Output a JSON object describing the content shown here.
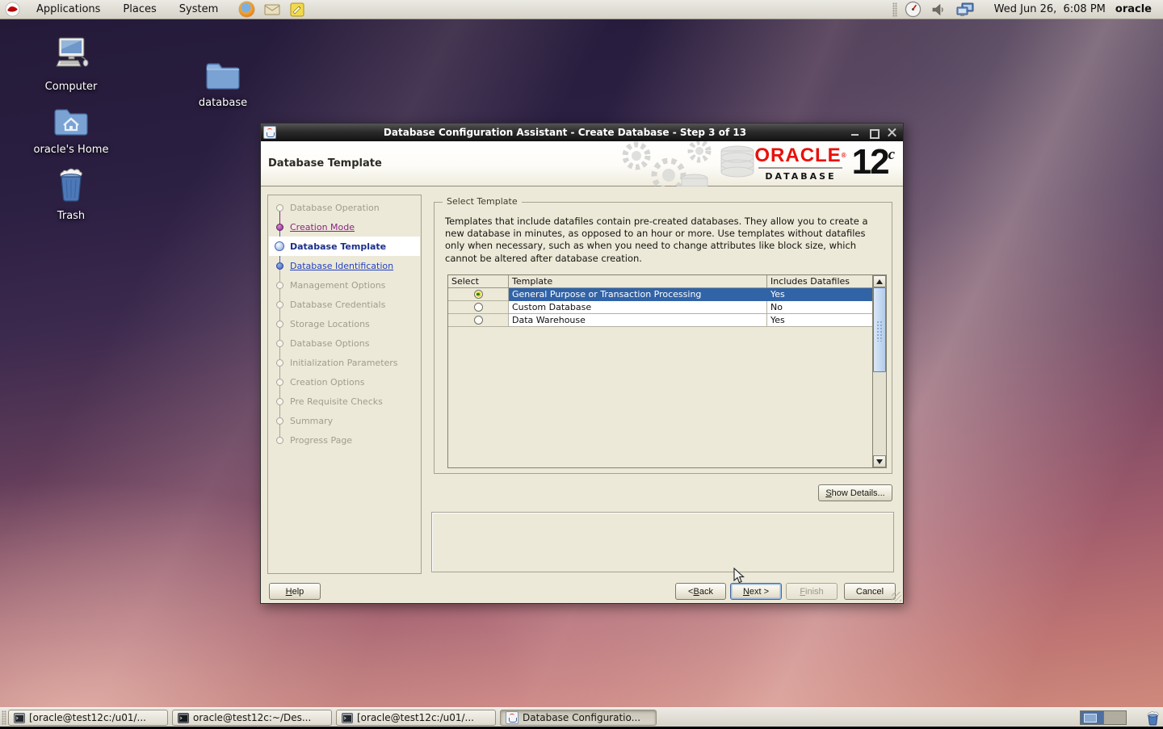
{
  "top_panel": {
    "menus": {
      "applications": "Applications",
      "places": "Places",
      "system": "System"
    },
    "clock": "Wed Jun 26,  6:08 PM",
    "user": "oracle"
  },
  "desktop": {
    "icons": {
      "computer": "Computer",
      "database": "database",
      "home": "oracle's Home",
      "trash": "Trash"
    }
  },
  "dialog": {
    "title": "Database Configuration Assistant - Create Database - Step 3 of 13",
    "page_title": "Database Template",
    "brand": {
      "name": "ORACLE",
      "reg": "®",
      "product": "DATABASE",
      "version": "12",
      "edition": "c"
    },
    "steps": [
      {
        "label": "Database Operation",
        "state": "pending"
      },
      {
        "label": "Creation Mode",
        "state": "visited"
      },
      {
        "label": "Database Template",
        "state": "current"
      },
      {
        "label": "Database Identification",
        "state": "link"
      },
      {
        "label": "Management Options",
        "state": "pending"
      },
      {
        "label": "Database Credentials",
        "state": "pending"
      },
      {
        "label": "Storage Locations",
        "state": "pending"
      },
      {
        "label": "Database Options",
        "state": "pending"
      },
      {
        "label": "Initialization Parameters",
        "state": "pending"
      },
      {
        "label": "Creation Options",
        "state": "pending"
      },
      {
        "label": "Pre Requisite Checks",
        "state": "pending"
      },
      {
        "label": "Summary",
        "state": "pending"
      },
      {
        "label": "Progress Page",
        "state": "pending"
      }
    ],
    "select_template": {
      "legend": "Select Template",
      "description": "Templates that include datafiles contain pre-created databases. They allow you to create a new database in minutes, as opposed to an hour or more. Use templates without datafiles only when necessary, such as when you need to change attributes like block size, which cannot be altered after database creation.",
      "columns": [
        "Select",
        "Template",
        "Includes Datafiles"
      ],
      "rows": [
        {
          "template": "General Purpose or Transaction Processing",
          "datafiles": "Yes",
          "selected": true
        },
        {
          "template": "Custom Database",
          "datafiles": "No",
          "selected": false
        },
        {
          "template": "Data Warehouse",
          "datafiles": "Yes",
          "selected": false
        }
      ]
    },
    "show_details": {
      "k": "S",
      "rest": "how Details..."
    },
    "buttons": {
      "help": {
        "pre": "",
        "k": "H",
        "rest": "elp"
      },
      "back": {
        "pre": "< ",
        "k": "B",
        "rest": "ack"
      },
      "next": {
        "pre": "",
        "k": "N",
        "rest": "ext >"
      },
      "finish": {
        "pre": "",
        "k": "F",
        "rest": "inish"
      },
      "cancel": {
        "label": "Cancel"
      }
    }
  },
  "taskbar": {
    "windows": [
      {
        "title": "[oracle@test12c:/u01/...",
        "icon": "terminal"
      },
      {
        "title": "oracle@test12c:~/Des...",
        "icon": "terminal"
      },
      {
        "title": "[oracle@test12c:/u01/...",
        "icon": "terminal"
      },
      {
        "title": "Database Configuratio...",
        "icon": "java-app"
      }
    ]
  },
  "colors": {
    "selection_blue": "#3163a7",
    "oracle_red": "#e8100c",
    "wizard_bg": "#ece9d8"
  }
}
